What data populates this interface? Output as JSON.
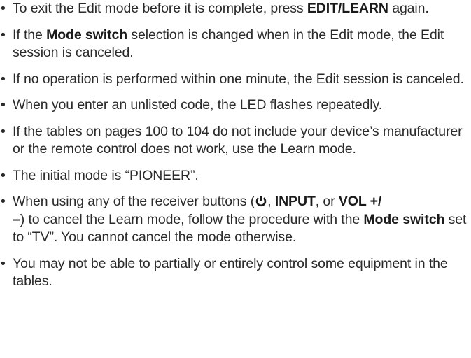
{
  "bullet_glyph": "•",
  "items": [
    {
      "id": "exit-edit",
      "parts": [
        {
          "t": "To exit the Edit mode before it is complete, press ",
          "b": false
        },
        {
          "t": "EDIT/LEARN",
          "b": true
        },
        {
          "t": " again.",
          "b": false
        }
      ]
    },
    {
      "id": "mode-switch-changed",
      "parts": [
        {
          "t": "If the ",
          "b": false
        },
        {
          "t": "Mode switch",
          "b": true
        },
        {
          "t": " selection is changed when in the Edit mode, the Edit session is canceled.",
          "b": false
        }
      ]
    },
    {
      "id": "one-minute-timeout",
      "parts": [
        {
          "t": "If no operation is performed within one minute, the Edit session is canceled.",
          "b": false
        }
      ]
    },
    {
      "id": "unlisted-code",
      "parts": [
        {
          "t": "When you enter an unlisted code, the LED flashes repeatedly.",
          "b": false
        }
      ]
    },
    {
      "id": "use-learn-mode",
      "parts": [
        {
          "t": "If the tables on pages 100 to 104 do not include your device’s manufacturer or the remote control does not work, use the Learn mode.",
          "b": false
        }
      ]
    },
    {
      "id": "initial-mode",
      "parts": [
        {
          "t": "The initial mode is “PIONEER”.",
          "b": false
        }
      ]
    },
    {
      "id": "cancel-learn-mode",
      "parts": [
        {
          "t": "When using any of the receiver buttons (",
          "b": false
        },
        {
          "icon": "power-icon"
        },
        {
          "t": ", ",
          "b": false
        },
        {
          "t": "INPUT",
          "b": true
        },
        {
          "t": ", or ",
          "b": false
        },
        {
          "t": "VOL +/\n–",
          "b": true
        },
        {
          "t": ") to cancel the Learn mode, follow the procedure with the ",
          "b": false
        },
        {
          "t": "Mode switch",
          "b": true
        },
        {
          "t": " set to “TV”. You cannot cancel the mode otherwise.",
          "b": false
        }
      ]
    },
    {
      "id": "partial-control",
      "parts": [
        {
          "t": "You may not be able to partially or entirely control some equipment in the tables.",
          "b": false
        }
      ]
    }
  ]
}
